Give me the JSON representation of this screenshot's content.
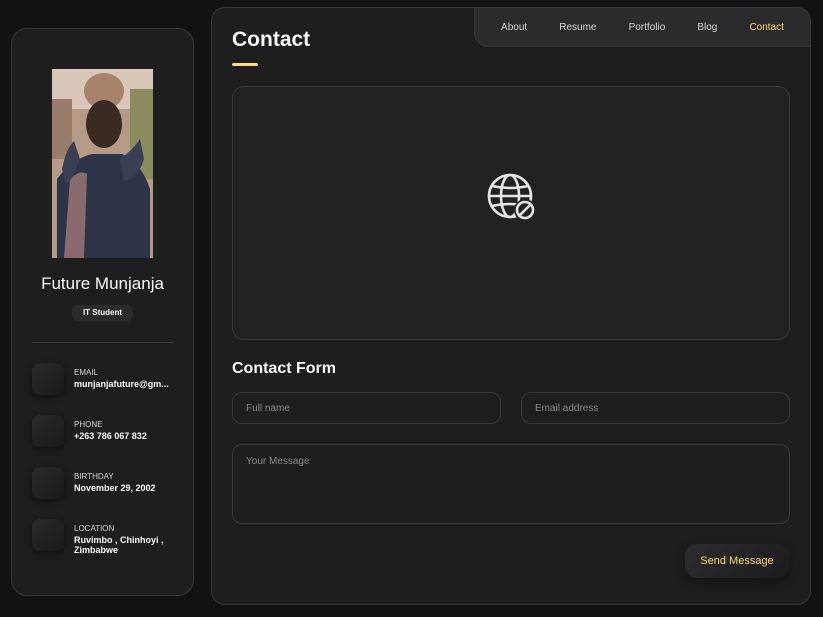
{
  "sidebar": {
    "name": "Future Munjanja",
    "role": "IT Student",
    "contacts": [
      {
        "title": "Email",
        "value": "munjanjafuture@gm..."
      },
      {
        "title": "Phone",
        "value": "+263 786 067 832"
      },
      {
        "title": "Birthday",
        "value": "November 29, 2002"
      },
      {
        "title": "Location",
        "value": "Ruvimbo , Chinhoyi , Zimbabwe"
      }
    ]
  },
  "navbar": {
    "items": [
      "About",
      "Resume",
      "Portfolio",
      "Blog",
      "Contact"
    ],
    "active": "Contact"
  },
  "main": {
    "title": "Contact",
    "map_icon": "globe-blocked-icon",
    "form": {
      "title": "Contact Form",
      "fullname_placeholder": "Full name",
      "email_placeholder": "Email address",
      "message_placeholder": "Your Message",
      "submit_label": "Send Message"
    }
  },
  "colors": {
    "accent": "#ffdb70",
    "panel": "#1e1e1f",
    "background": "#121212",
    "border": "#383838"
  }
}
